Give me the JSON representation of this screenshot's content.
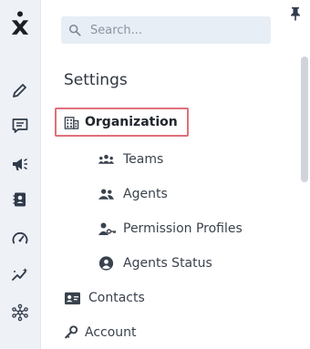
{
  "rail": {
    "items": [
      {
        "icon": "pencil-icon"
      },
      {
        "icon": "chat-icon"
      },
      {
        "icon": "megaphone-icon"
      },
      {
        "icon": "contact-card-icon"
      },
      {
        "icon": "speedometer-icon"
      },
      {
        "icon": "sparkle-trend-icon"
      },
      {
        "icon": "network-icon"
      }
    ]
  },
  "search": {
    "placeholder": "Search..."
  },
  "settings": {
    "title": "Settings",
    "items": [
      {
        "label": "Organization",
        "icon": "building-icon",
        "selected": true
      },
      {
        "label": "Teams",
        "icon": "teams-icon"
      },
      {
        "label": "Agents",
        "icon": "agents-icon"
      },
      {
        "label": "Permission Profiles",
        "icon": "user-key-icon"
      },
      {
        "label": "Agents Status",
        "icon": "agent-status-icon"
      },
      {
        "label": "Contacts",
        "icon": "contacts-icon"
      },
      {
        "label": "Account",
        "icon": "key-icon"
      }
    ]
  },
  "colors": {
    "highlight_border": "#e0707a",
    "rail_background": "#eef1f6",
    "search_background": "#e8eef6"
  }
}
